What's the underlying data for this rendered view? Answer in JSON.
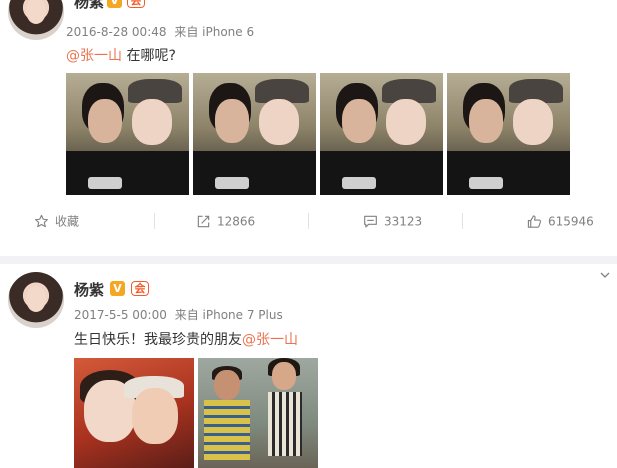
{
  "posts": [
    {
      "username": "杨紫",
      "vip_badge": "V",
      "member_badge": "会",
      "date": "2016-8-28 00:48",
      "source": "来自 iPhone 6",
      "mention": "@张一山",
      "text": "在哪呢?",
      "photo_count": 4,
      "actions": {
        "favorite_label": "收藏",
        "repost_count": "12866",
        "comment_count": "33123",
        "like_count": "615946"
      }
    },
    {
      "username": "杨紫",
      "vip_badge": "V",
      "member_badge": "会",
      "date": "2017-5-5 00:00",
      "source": "来自 iPhone 7 Plus",
      "text": "生日快乐！我最珍贵的朋友",
      "mention": "@张一山",
      "photo_count": 2
    }
  ],
  "colors": {
    "mention": "#eb7350",
    "meta": "#808080",
    "vip_badge": "#f5a623",
    "member_badge": "#f35c2a"
  },
  "icons": [
    "star-icon",
    "repost-icon",
    "comment-icon",
    "thumbs-up-icon",
    "chevron-down-icon"
  ]
}
